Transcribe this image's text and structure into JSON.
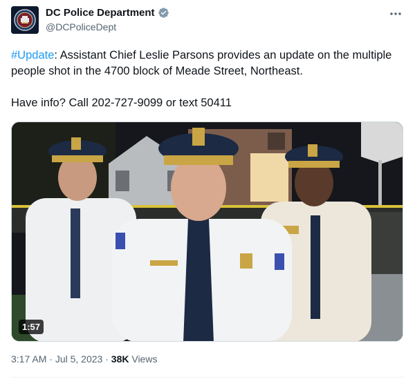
{
  "author": {
    "display_name": "DC Police Department",
    "handle": "@DCPoliceDept",
    "verified_color": "#829aab"
  },
  "tweet": {
    "hashtag": "#Update",
    "line1_rest": ": Assistant Chief Leslie Parsons provides an update on the multiple people shot in the 4700 block of Meade Street, Northeast.",
    "line2": "Have info? Call 202-727-9099 or text 50411"
  },
  "media": {
    "duration": "1:57"
  },
  "meta": {
    "time": "3:17 AM",
    "separator1": " · ",
    "date": "Jul 5, 2023",
    "separator2": " · ",
    "views_count": "38K",
    "views_label": " Views"
  },
  "colors": {
    "link": "#1d9bf0",
    "secondary_text": "#536471",
    "primary_text": "#0f1419"
  },
  "icons": {
    "verified": "verified-badge-icon",
    "more": "more-horizontal-icon"
  }
}
